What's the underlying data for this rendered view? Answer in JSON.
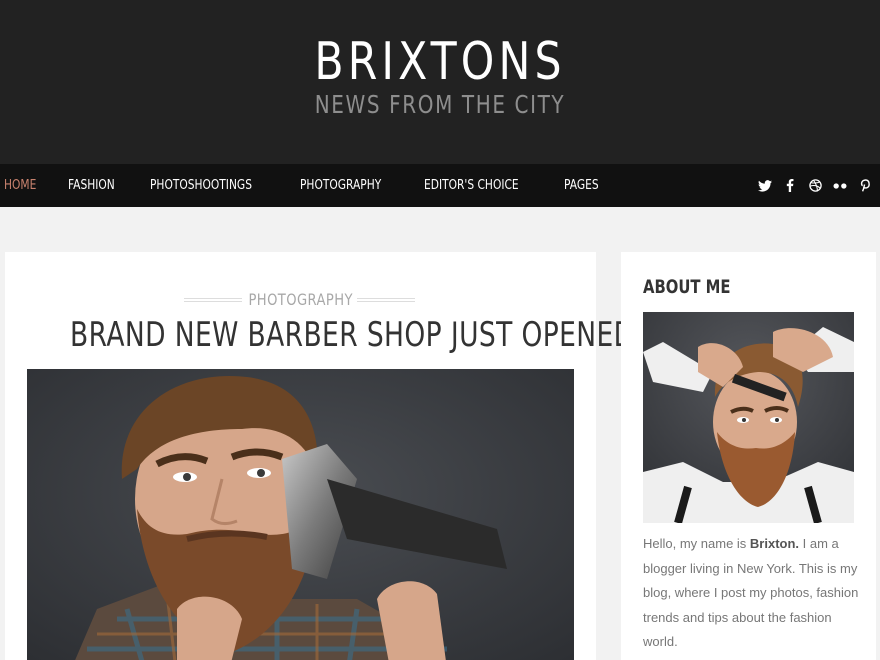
{
  "header": {
    "title": "BRIXTONS",
    "tagline": "NEWS FROM THE CITY"
  },
  "nav": {
    "items": [
      "HOME",
      "FASHION",
      "PHOTOSHOOTINGS",
      "PHOTOGRAPHY",
      "EDITOR'S CHOICE",
      "PAGES"
    ],
    "active_index": 0
  },
  "social": [
    "twitter-icon",
    "facebook-icon",
    "dribbble-icon",
    "flickr-icon",
    "pinterest-icon"
  ],
  "post": {
    "category": "PHOTOGRAPHY",
    "title": "BRAND NEW BARBER SHOP JUST OPENED"
  },
  "sidebar": {
    "widget_title": "ABOUT ME",
    "about_pre": "Hello, my name is ",
    "about_name": "Brixton.",
    "about_post": " I am a blogger living in New York. This is my blog, where I post my photos, fashion trends and tips about the fashion world."
  },
  "colors": {
    "header_bg": "#222222",
    "nav_bg": "#111111",
    "accent": "#c8826e",
    "page_bg": "#f2f2f2"
  }
}
